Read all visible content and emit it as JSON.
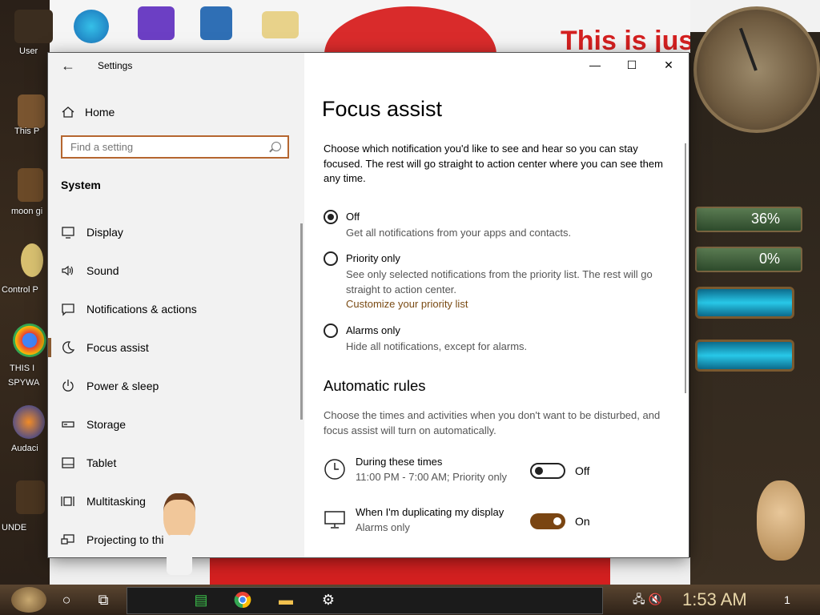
{
  "desktop": {
    "icons": [
      {
        "label": "User"
      },
      {
        "label": "This P"
      },
      {
        "label": "moon gi"
      },
      {
        "label": "Control P"
      },
      {
        "label": "THIS I"
      },
      {
        "label": "SPYWA"
      },
      {
        "label": "Audaci"
      },
      {
        "label": "UNDE"
      }
    ],
    "banner_text": "This is jus",
    "meters": [
      {
        "label": "36%"
      },
      {
        "label": "0%"
      }
    ]
  },
  "window": {
    "app_title": "Settings",
    "controls": {
      "minimize": "—",
      "maximize": "☐",
      "close": "✕"
    }
  },
  "sidebar": {
    "home_label": "Home",
    "search_placeholder": "Find a setting",
    "section_title": "System",
    "items": [
      {
        "label": "Display",
        "icon": "monitor-icon"
      },
      {
        "label": "Sound",
        "icon": "speaker-icon"
      },
      {
        "label": "Notifications & actions",
        "icon": "notification-icon"
      },
      {
        "label": "Focus assist",
        "icon": "moon-icon",
        "active": true
      },
      {
        "label": "Power & sleep",
        "icon": "power-icon"
      },
      {
        "label": "Storage",
        "icon": "storage-icon"
      },
      {
        "label": "Tablet",
        "icon": "tablet-icon"
      },
      {
        "label": "Multitasking",
        "icon": "multitasking-icon"
      },
      {
        "label": "Projecting to thi",
        "icon": "projector-icon"
      }
    ]
  },
  "main": {
    "title": "Focus assist",
    "description": "Choose which notification you'd like to see and hear so you can stay focused. The rest will go straight to action center where you can see them any time.",
    "options": [
      {
        "label": "Off",
        "desc": "Get all notifications from your apps and contacts.",
        "selected": true
      },
      {
        "label": "Priority only",
        "desc": "See only selected notifications from the priority list. The rest will go straight to action center.",
        "link": "Customize your priority list",
        "selected": false
      },
      {
        "label": "Alarms only",
        "desc": "Hide all notifications, except for alarms.",
        "selected": false
      }
    ],
    "rules_title": "Automatic rules",
    "rules_desc": "Choose the times and activities when you don't want to be disturbed, and focus assist will turn on automatically.",
    "rules": [
      {
        "title": "During these times",
        "sub": "11:00 PM - 7:00 AM; Priority only",
        "state": "Off",
        "on": false,
        "icon": "clock-icon"
      },
      {
        "title": "When I'm duplicating my display",
        "sub": "Alarms only",
        "state": "On",
        "on": true,
        "icon": "display-icon"
      }
    ]
  },
  "taskbar": {
    "time": "1:53 AM",
    "notification_count": "1"
  },
  "colors": {
    "accent": "#7a4512",
    "link": "#7a4b14",
    "search_border": "#b5662f"
  }
}
